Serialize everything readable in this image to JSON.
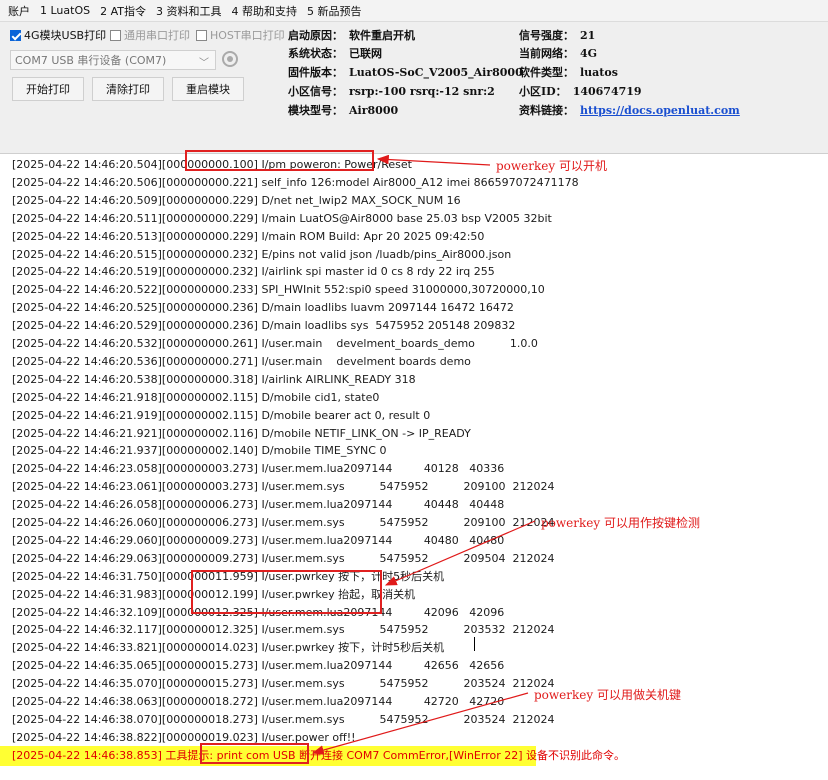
{
  "menu": [
    "账户",
    "1 LuatOS",
    "2 AT指令",
    "3 资料和工具",
    "4 帮助和支持",
    "5 新品预告"
  ],
  "options": {
    "usb4g": {
      "label": "4G模块USB打印",
      "checked": true
    },
    "generic": {
      "label": "通用串口打印",
      "checked": false
    },
    "host": {
      "label": "HOST串口打印",
      "checked": false
    }
  },
  "port": {
    "value": "COM7 USB 串行设备 (COM7)"
  },
  "buttons": {
    "start": "开始打印",
    "clear": "清除打印",
    "restart": "重启模块"
  },
  "info": {
    "boot_reason_label": "启动原因：",
    "boot_reason": "软件重启开机",
    "system_status_label": "系统状态：",
    "system_status": "已联网",
    "firmware_label": "固件版本：",
    "firmware": "LuatOS-SoC_V2005_Air8000",
    "cell_signal_label": "小区信号：",
    "cell_signal": "rsrp:-100 rsrq:-12 snr:2",
    "model_label": "模块型号：",
    "model": "Air8000",
    "signal_label": "信号强度：",
    "signal": "21",
    "network_label": "当前网络：",
    "network": "4G",
    "software_type_label": "软件类型：",
    "software_type": "luatos",
    "cell_id_label": "小区ID：",
    "cell_id": "140674719",
    "doc_label": "资料链接：",
    "doc_link": "https://docs.openluat.com"
  },
  "log": [
    "[2025-04-22 14:46:20.504][000000000.100] I/pm poweron: Power/Reset",
    "[2025-04-22 14:46:20.506][000000000.221] self_info 126:model Air8000_A12 imei 866597072471178",
    "[2025-04-22 14:46:20.509][000000000.229] D/net net_lwip2 MAX_SOCK_NUM 16",
    "[2025-04-22 14:46:20.511][000000000.229] I/main LuatOS@Air8000 base 25.03 bsp V2005 32bit",
    "[2025-04-22 14:46:20.513][000000000.229] I/main ROM Build: Apr 20 2025 09:42:50",
    "[2025-04-22 14:46:20.515][000000000.232] E/pins not valid json /luadb/pins_Air8000.json",
    "[2025-04-22 14:46:20.519][000000000.232] I/airlink spi master id 0 cs 8 rdy 22 irq 255",
    "[2025-04-22 14:46:20.522][000000000.233] SPI_HWInit 552:spi0 speed 31000000,30720000,10",
    "[2025-04-22 14:46:20.525][000000000.236] D/main loadlibs luavm 2097144 16472 16472",
    "[2025-04-22 14:46:20.529][000000000.236] D/main loadlibs sys  5475952 205148 209832",
    "[2025-04-22 14:46:20.532][000000000.261] I/user.main    develment_boards_demo          1.0.0",
    "[2025-04-22 14:46:20.536][000000000.271] I/user.main    develment boards demo",
    "[2025-04-22 14:46:20.538][000000000.318] I/airlink AIRLINK_READY 318",
    "[2025-04-22 14:46:21.918][000000002.115] D/mobile cid1, state0",
    "[2025-04-22 14:46:21.919][000000002.115] D/mobile bearer act 0, result 0",
    "[2025-04-22 14:46:21.921][000000002.116] D/mobile NETIF_LINK_ON -> IP_READY",
    "[2025-04-22 14:46:21.937][000000002.140] D/mobile TIME_SYNC 0",
    "[2025-04-22 14:46:23.058][000000003.273] I/user.mem.lua2097144         40128   40336",
    "[2025-04-22 14:46:23.061][000000003.273] I/user.mem.sys          5475952          209100  212024",
    "[2025-04-22 14:46:26.058][000000006.273] I/user.mem.lua2097144         40448   40448",
    "[2025-04-22 14:46:26.060][000000006.273] I/user.mem.sys          5475952          209100  212024",
    "[2025-04-22 14:46:29.060][000000009.273] I/user.mem.lua2097144         40480   40480",
    "[2025-04-22 14:46:29.063][000000009.273] I/user.mem.sys          5475952          209504  212024",
    "[2025-04-22 14:46:31.750][000000011.959] I/user.pwrkey 按下，计时5秒后关机",
    "[2025-04-22 14:46:31.983][000000012.199] I/user.pwrkey 抬起，取消关机",
    "[2025-04-22 14:46:32.109][000000012.325] I/user.mem.lua2097144         42096   42096",
    "[2025-04-22 14:46:32.117][000000012.325] I/user.mem.sys          5475952          203532  212024",
    "[2025-04-22 14:46:33.821][000000014.023] I/user.pwrkey 按下，计时5秒后关机",
    "[2025-04-22 14:46:35.065][000000015.273] I/user.mem.lua2097144         42656   42656",
    "[2025-04-22 14:46:35.070][000000015.273] I/user.mem.sys          5475952          203524  212024",
    "[2025-04-22 14:46:38.063][000000018.272] I/user.mem.lua2097144         42720   42720",
    "[2025-04-22 14:46:38.070][000000018.273] I/user.mem.sys          5475952          203524  212024",
    "[2025-04-22 14:46:38.822][000000019.023] I/user.power off!!",
    "[2025-04-22 14:46:38.853] 工具提示: print com USB 断开连接 COM7 CommError,[WinError 22] 设备不识别此命令。"
  ],
  "annotations": {
    "poweron": "powerkey  可以开机",
    "detect": "powerkey  可以用作按键检测",
    "shutdown": "powerkey  可以用做关机键"
  },
  "colors": {
    "annotation": "#e01a1a",
    "highlight": "#ffff33",
    "link": "#1a4fd0",
    "checked": "#0a64d8"
  }
}
